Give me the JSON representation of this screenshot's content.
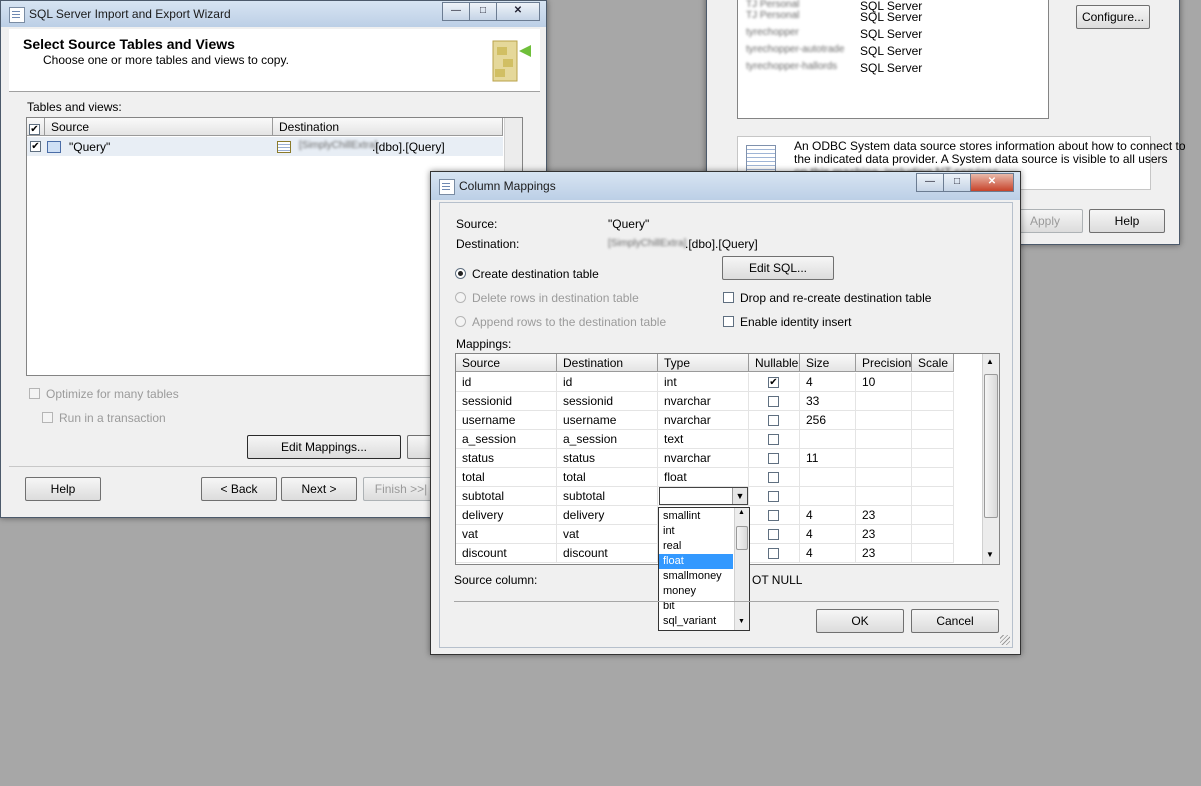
{
  "wizard": {
    "title": "SQL Server Import and Export Wizard",
    "header_title": "Select Source Tables and Views",
    "header_subtitle": "Choose one or more tables and views to copy.",
    "tables_label": "Tables and views:",
    "col_source": "Source",
    "col_destination": "Destination",
    "row_source": "\"Query\"",
    "row_dest_server": "[SimplyChillExtra]",
    "row_dest_rest": ".[dbo].[Query]",
    "optimize": "Optimize for many tables",
    "run_transaction": "Run in a transaction",
    "edit_mappings": "Edit Mappings...",
    "help": "Help",
    "back": "< Back",
    "next": "Next >",
    "finish": "Finish >>|"
  },
  "odbc": {
    "rows": [
      {
        "name": "TJ Personal",
        "driver": "SQL Server"
      },
      {
        "name": "TJ Personal",
        "driver": "SQL Server"
      },
      {
        "name": "tyrechopper",
        "driver": "SQL Server"
      },
      {
        "name": "tyrechopper-autotrade",
        "driver": "SQL Server"
      },
      {
        "name": "tyrechopper-hallords",
        "driver": "SQL Server"
      }
    ],
    "configure": "Configure...",
    "info_line1": "An ODBC System data source stores information about how to connect to",
    "info_line2": "the indicated data provider.  A System data source is visible to all users",
    "info_line3": "on this machine, including NT services.",
    "apply": "Apply",
    "help": "Help"
  },
  "mappings": {
    "title": "Column Mappings",
    "source_label": "Source:",
    "source_value": "\"Query\"",
    "dest_label": "Destination:",
    "dest_server": "[SimplyChillExtra]",
    "dest_rest": ".[dbo].[Query]",
    "create_table": "Create destination table",
    "delete_rows": "Delete rows in destination table",
    "append_rows": "Append rows to the destination table",
    "edit_sql": "Edit SQL...",
    "drop_recreate": "Drop and re-create destination table",
    "identity_insert": "Enable identity insert",
    "mappings_label": "Mappings:",
    "headers": [
      "Source",
      "Destination",
      "Type",
      "Nullable",
      "Size",
      "Precision",
      "Scale"
    ],
    "rows": [
      {
        "source": "id",
        "dest": "id",
        "type": "int",
        "nullable": "✔",
        "size": "4",
        "precision": "10",
        "scale": ""
      },
      {
        "source": "sessionid",
        "dest": "sessionid",
        "type": "nvarchar",
        "nullable": "",
        "size": "33",
        "precision": "",
        "scale": ""
      },
      {
        "source": "username",
        "dest": "username",
        "type": "nvarchar",
        "nullable": "",
        "size": "256",
        "precision": "",
        "scale": ""
      },
      {
        "source": "a_session",
        "dest": "a_session",
        "type": "text",
        "nullable": "",
        "size": "",
        "precision": "",
        "scale": ""
      },
      {
        "source": "status",
        "dest": "status",
        "type": "nvarchar",
        "nullable": "",
        "size": "11",
        "precision": "",
        "scale": ""
      },
      {
        "source": "total",
        "dest": "total",
        "type": "float",
        "nullable": "",
        "size": "",
        "precision": "",
        "scale": ""
      },
      {
        "source": "subtotal",
        "dest": "subtotal",
        "type": "",
        "nullable": "",
        "size": "",
        "precision": "",
        "scale": ""
      },
      {
        "source": "delivery",
        "dest": "delivery",
        "type": "",
        "nullable": "",
        "size": "4",
        "precision": "23",
        "scale": ""
      },
      {
        "source": "vat",
        "dest": "vat",
        "type": "",
        "nullable": "",
        "size": "4",
        "precision": "23",
        "scale": ""
      },
      {
        "source": "discount",
        "dest": "discount",
        "type": "",
        "nullable": "",
        "size": "4",
        "precision": "23",
        "scale": ""
      }
    ],
    "type_options": [
      "smallint",
      "int",
      "real",
      "float",
      "smallmoney",
      "money",
      "bit",
      "sql_variant"
    ],
    "type_selected": "float",
    "source_column_label": "Source column:",
    "source_column_value": "OT NULL",
    "ok": "OK",
    "cancel": "Cancel"
  }
}
